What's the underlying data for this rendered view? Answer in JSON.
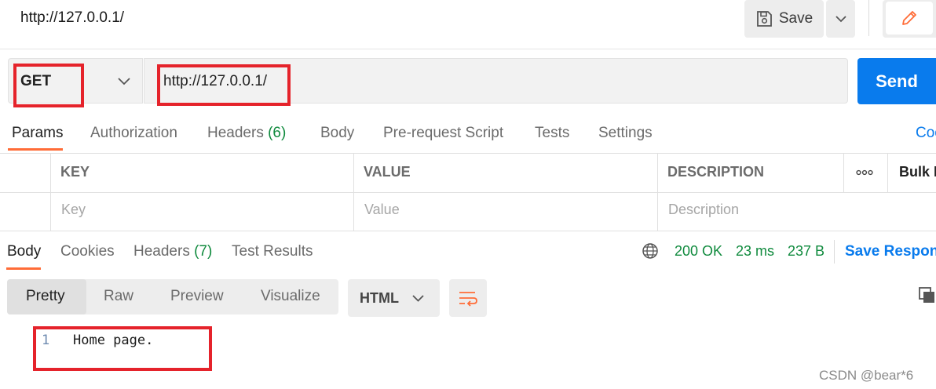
{
  "top_bar": {
    "title": "http://127.0.0.1/",
    "save_label": "Save"
  },
  "request": {
    "method": "GET",
    "url": "http://127.0.0.1/",
    "send_label": "Send"
  },
  "request_tabs": {
    "params": "Params",
    "authorization": "Authorization",
    "headers": "Headers",
    "headers_count": "(6)",
    "body": "Body",
    "pre_request_script": "Pre-request Script",
    "tests": "Tests",
    "settings": "Settings",
    "cookies_link": "Coo"
  },
  "params_table": {
    "columns": {
      "key": "KEY",
      "value": "VALUE",
      "description": "DESCRIPTION"
    },
    "placeholders": {
      "key": "Key",
      "value": "Value",
      "description": "Description"
    },
    "bulk_edit": "Bulk E"
  },
  "response_tabs": {
    "body": "Body",
    "cookies": "Cookies",
    "headers": "Headers",
    "headers_count": "(7)",
    "test_results": "Test Results"
  },
  "response_status": {
    "status": "200 OK",
    "time": "23 ms",
    "size": "237 B",
    "save_response": "Save Respons"
  },
  "view_modes": {
    "pretty": "Pretty",
    "raw": "Raw",
    "preview": "Preview",
    "visualize": "Visualize"
  },
  "format": "HTML",
  "response_body": {
    "line_number": "1",
    "line_text": "Home page."
  },
  "watermark": "CSDN @bear*6",
  "colors": {
    "accent_orange": "#ff6c37",
    "send_blue": "#097bed",
    "status_green": "#0f8a3d",
    "annotation_red": "#e5232b"
  }
}
